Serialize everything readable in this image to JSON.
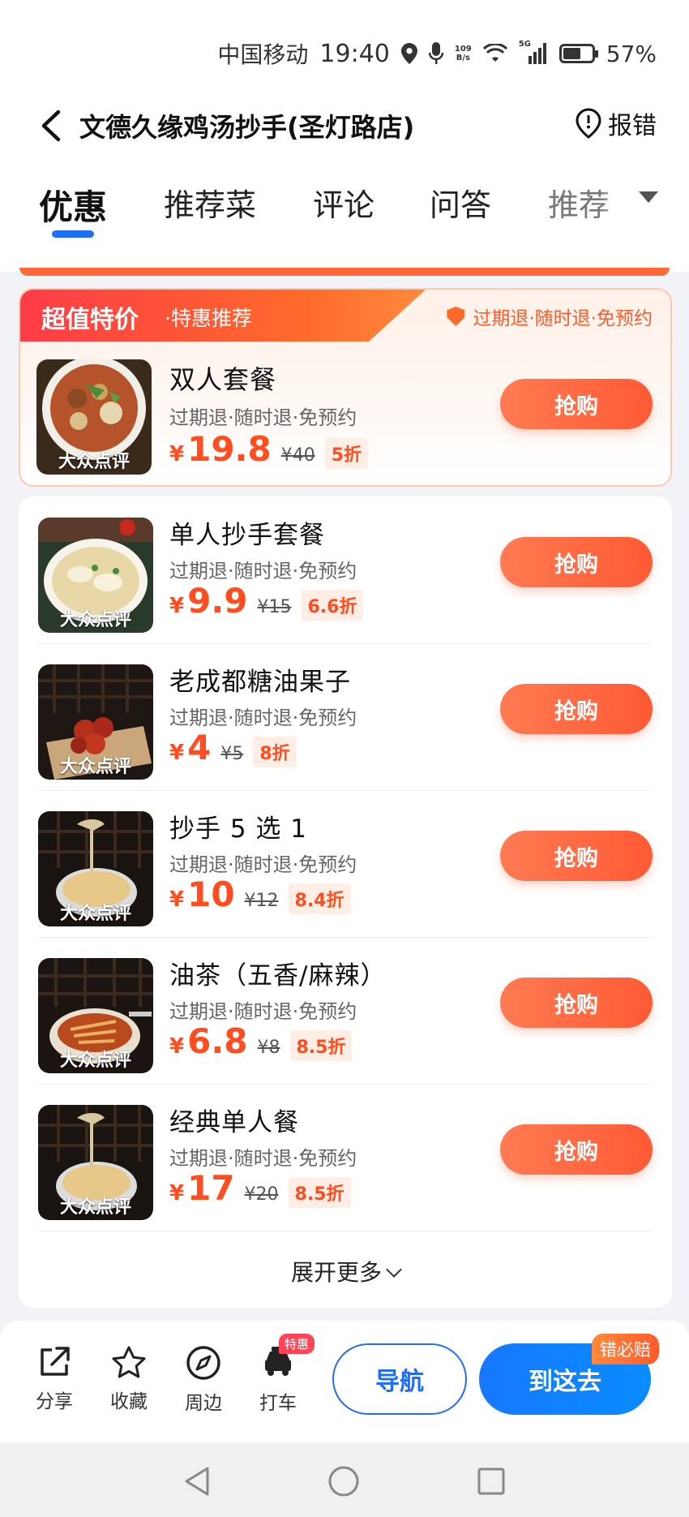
{
  "status_bar": {
    "carrier": "中国移动",
    "time": "19:40",
    "net_speed_top": "109",
    "net_speed_bottom": "B/s",
    "signal": "5G",
    "battery_pct": "57%",
    "battery_level": 0.57
  },
  "header": {
    "title": "文德久缘鸡汤抄手(圣灯路店)",
    "report_label": "报错"
  },
  "tabs": [
    {
      "label": "优惠",
      "active": true
    },
    {
      "label": "推荐菜"
    },
    {
      "label": "评论"
    },
    {
      "label": "问答"
    },
    {
      "label": "推荐"
    }
  ],
  "featured": {
    "ribbon_title": "超值特价",
    "ribbon_sub": "·特惠推荐",
    "guarantee": "过期退·随时退·免预约",
    "deal": {
      "name": "双人套餐",
      "tags": "过期退·随时退·免预约",
      "yen": "¥",
      "price": "19.8",
      "orig": "¥40",
      "discount": "5折",
      "button": "抢购",
      "watermark": "大众点评"
    }
  },
  "deals": [
    {
      "name": "单人抄手套餐",
      "tags": "过期退·随时退·免预约",
      "yen": "¥",
      "price": "9.9",
      "orig": "¥15",
      "discount": "6.6折",
      "button": "抢购",
      "watermark": "大众点评"
    },
    {
      "name": "老成都糖油果子",
      "tags": "过期退·随时退·免预约",
      "yen": "¥",
      "price": "4",
      "orig": "¥5",
      "discount": "8折",
      "button": "抢购",
      "watermark": "大众点评"
    },
    {
      "name": "抄手 5 选 1",
      "tags": "过期退·随时退·免预约",
      "yen": "¥",
      "price": "10",
      "orig": "¥12",
      "discount": "8.4折",
      "button": "抢购",
      "watermark": "大众点评"
    },
    {
      "name": "油茶（五香/麻辣）",
      "tags": "过期退·随时退·免预约",
      "yen": "¥",
      "price": "6.8",
      "orig": "¥8",
      "discount": "8.5折",
      "button": "抢购",
      "watermark": "大众点评"
    },
    {
      "name": "经典单人餐",
      "tags": "过期退·随时退·免预约",
      "yen": "¥",
      "price": "17",
      "orig": "¥20",
      "discount": "8.5折",
      "button": "抢购",
      "watermark": "大众点评"
    }
  ],
  "expand_label": "展开更多",
  "bottom_bar": {
    "share": "分享",
    "favorite": "收藏",
    "nearby": "周边",
    "taxi": "打车",
    "taxi_badge": "特惠",
    "navigate": "导航",
    "go_here": "到这去",
    "go_badge": "错必赔"
  },
  "colors": {
    "accent_blue": "#1f6ef5",
    "deal_orange": "#ff5a34",
    "price_orange": "#ff4d1f"
  }
}
